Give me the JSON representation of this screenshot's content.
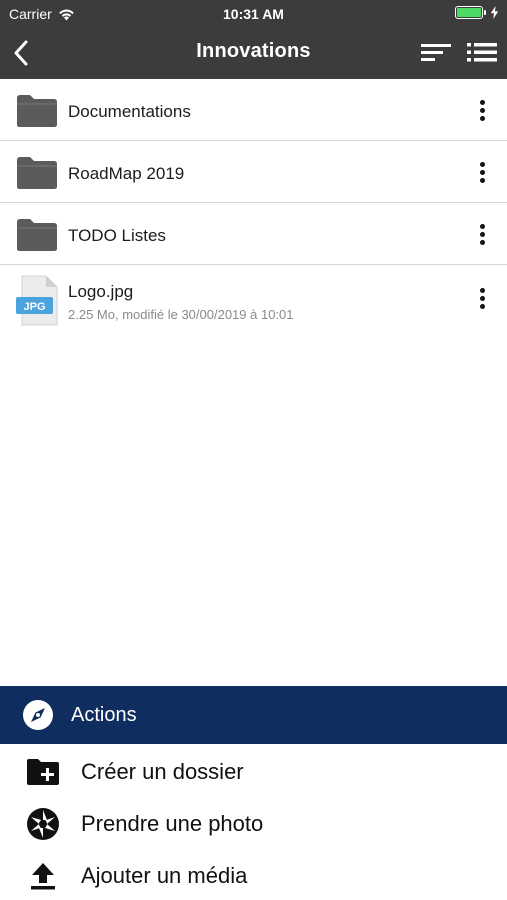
{
  "status_bar": {
    "carrier": "Carrier",
    "time": "10:31 AM",
    "battery_level": 1.0,
    "battery_color": "#4cd964"
  },
  "nav": {
    "title": "Innovations",
    "back_icon": "chevron-left-icon",
    "sort_icon": "sort-icon",
    "list_icon": "list-view-icon"
  },
  "files": [
    {
      "name": "Documentations",
      "type": "folder"
    },
    {
      "name": "RoadMap 2019",
      "type": "folder"
    },
    {
      "name": "TODO Listes",
      "type": "folder"
    },
    {
      "name": "Logo.jpg",
      "type": "file",
      "badge": "JPG",
      "meta": "2.25 Mo, modifié le 30/00/2019 à 10:01"
    }
  ],
  "actions": {
    "title": "Actions",
    "header_color": "#0f2d5e",
    "items": [
      {
        "label": "Créer un dossier",
        "icon": "folder-plus-icon"
      },
      {
        "label": "Prendre une photo",
        "icon": "camera-aperture-icon"
      },
      {
        "label": "Ajouter un média",
        "icon": "upload-icon"
      }
    ]
  }
}
